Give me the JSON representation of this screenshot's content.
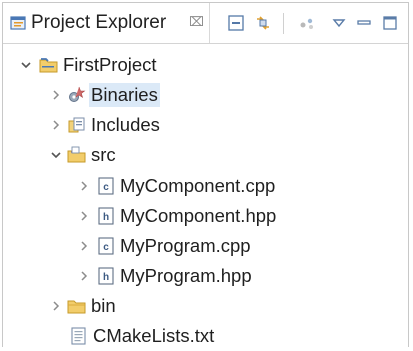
{
  "view": {
    "tab_label": "Project Explorer",
    "tab_close_glyph": "⌧",
    "tab_icon": "project-explorer-icon",
    "toolbar": [
      {
        "name": "collapse-all-icon"
      },
      {
        "name": "link-with-editor-icon"
      },
      {
        "name": "filter-icon"
      },
      {
        "name": "view-menu-icon"
      },
      {
        "name": "minimize-icon"
      },
      {
        "name": "maximize-icon"
      }
    ]
  },
  "tree": {
    "project": {
      "label": "FirstProject",
      "expanded": true
    },
    "binaries": {
      "label": "Binaries",
      "expanded": false,
      "selected": true
    },
    "includes": {
      "label": "Includes",
      "expanded": false
    },
    "src": {
      "label": "src",
      "expanded": true
    },
    "files": [
      {
        "label": "MyComponent.cpp",
        "type": "c-source-file-icon"
      },
      {
        "label": "MyComponent.hpp",
        "type": "h-header-file-icon"
      },
      {
        "label": "MyProgram.cpp",
        "type": "c-source-file-icon"
      },
      {
        "label": "MyProgram.hpp",
        "type": "h-header-file-icon"
      }
    ],
    "bin": {
      "label": "bin",
      "expanded": false
    },
    "cmakelists": {
      "label": "CMakeLists.txt"
    }
  },
  "colors": {
    "selection": "#dbe9f7",
    "folder": "#e8b84a",
    "project_folder": "#e8b84a"
  }
}
